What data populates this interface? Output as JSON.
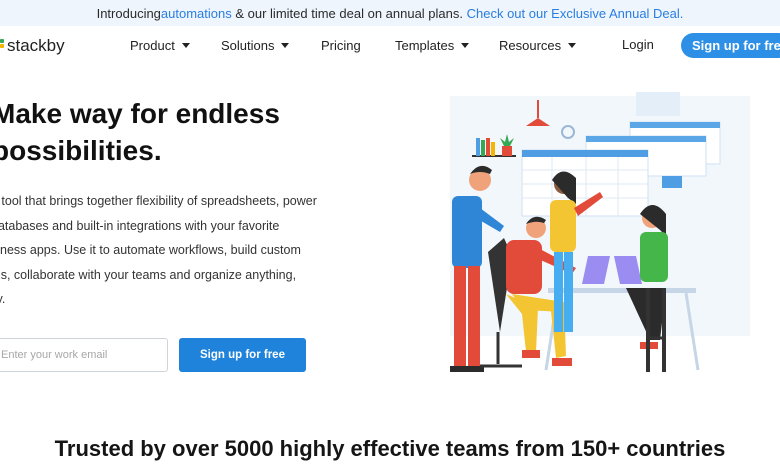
{
  "banner": {
    "prefix": "Introducing ",
    "link_automations": "automations",
    "middle": " & our limited time deal on annual plans. ",
    "link_deal": "Check out our Exclusive Annual Deal."
  },
  "nav": {
    "logo": "stackby",
    "items": [
      {
        "label": "Product",
        "dropdown": true
      },
      {
        "label": "Solutions",
        "dropdown": true
      },
      {
        "label": "Pricing",
        "dropdown": false
      },
      {
        "label": "Templates",
        "dropdown": true
      },
      {
        "label": "Resources",
        "dropdown": true
      }
    ],
    "login": "Login",
    "signup": "Sign up for free"
  },
  "hero": {
    "title_line1": "Make way for endless",
    "title_line2": "possibilities.",
    "description": "e tool that brings together flexibility of spreadsheets, power\ndatabases and built-in integrations with your favorite\nsiness apps. Use it to automate workflows, build custom\nols, collaborate with your teams and organize anything,\nlly.",
    "email_placeholder": "Enter your work email",
    "cta": "Sign up for free"
  },
  "trusted": "Trusted by over 5000 highly effective teams from 150+ countries",
  "colors": {
    "accent": "#2d8fe6",
    "cta": "#1f83dc",
    "banner_bg": "#eef5fd",
    "link": "#2a7de1"
  },
  "icons": [
    "caret-down-icon",
    "logo-mark-icon"
  ]
}
